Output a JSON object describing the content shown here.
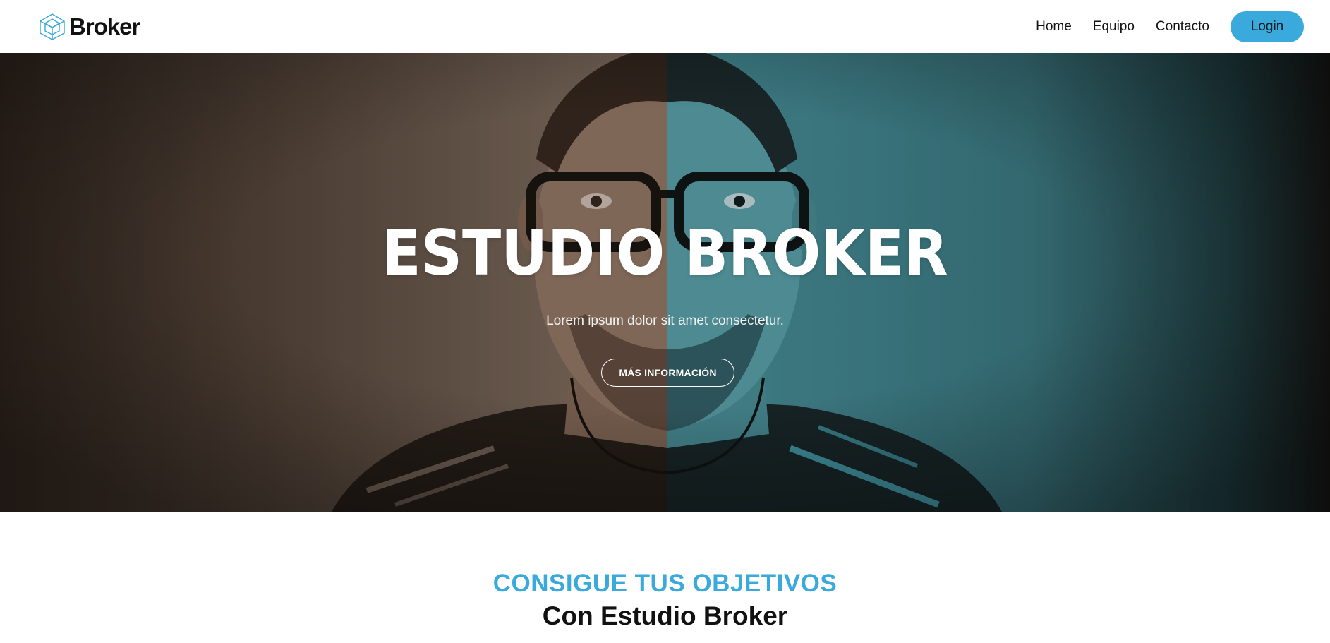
{
  "header": {
    "brand_name": "Broker",
    "brand_logo_icon": "wireframe-cube-icon",
    "brand_color": "#3aa9dc",
    "nav": [
      {
        "label": "Home"
      },
      {
        "label": "Equipo"
      },
      {
        "label": "Contacto"
      }
    ],
    "login_label": "Login"
  },
  "hero": {
    "title": "ESTUDIO BROKER",
    "subtitle": "Lorem ipsum dolor sit amet consectetur.",
    "cta_label": "MÁS INFORMACIÓN",
    "image": "split-toned portrait of man with glasses (sepia left, teal right)",
    "tone_left": "#8a7564",
    "tone_right": "#4e98a3"
  },
  "section": {
    "eyebrow": "CONSIGUE TUS OBJETIVOS",
    "heading": "Con Estudio Broker",
    "accent_color": "#3aa9dc"
  }
}
